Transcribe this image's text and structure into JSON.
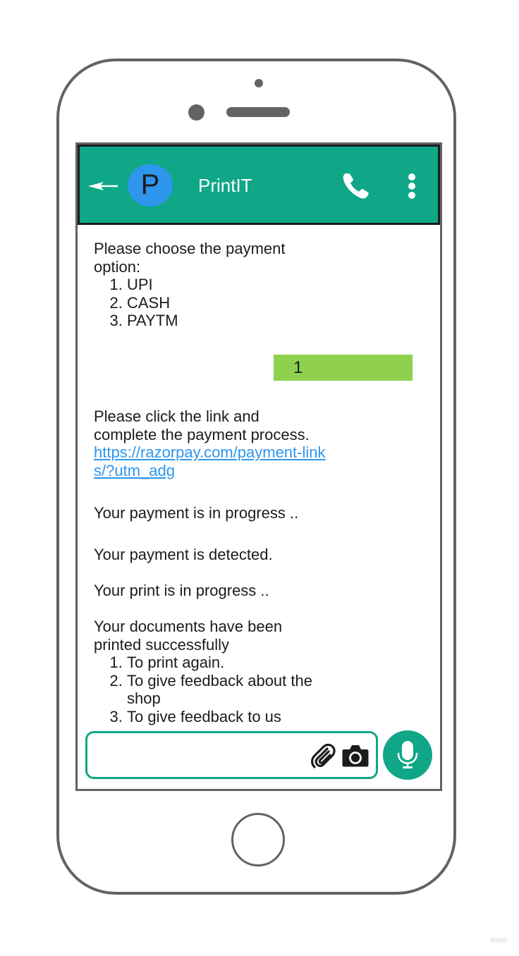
{
  "header": {
    "avatar_letter": "P",
    "contact_name": "PrintIT",
    "icons": {
      "back": "back-arrow-icon",
      "call": "phone-icon",
      "menu": "more-vertical-icon"
    }
  },
  "messages": [
    {
      "direction": "received",
      "text": "Please choose the payment option:",
      "list": [
        "UPI",
        "CASH",
        "PAYTM"
      ]
    },
    {
      "direction": "sent",
      "text": "1"
    },
    {
      "direction": "received",
      "text": "Please click the link and complete the payment process.",
      "link": "https://razorpay.com/payment-links/?utm_adg"
    },
    {
      "direction": "received",
      "text": "Your payment is in progress .."
    },
    {
      "direction": "received",
      "text": "Your payment is detected."
    },
    {
      "direction": "received",
      "text": "Your print is in progress .."
    },
    {
      "direction": "received",
      "text": "Your documents have been printed successfully",
      "list": [
        "To print again.",
        "To give feedback about the shop",
        "To give feedback to us"
      ]
    }
  ],
  "composer": {
    "value": "",
    "placeholder": "",
    "icons": {
      "attach": "paperclip-icon",
      "camera": "camera-icon",
      "mic": "microphone-icon"
    }
  },
  "colors": {
    "header_bg": "#0fa787",
    "avatar_bg": "#2e96ec",
    "sent_bubble": "#8fd14f",
    "link": "#2e96ec",
    "device_frame": "#636363"
  },
  "watermark": "miro"
}
